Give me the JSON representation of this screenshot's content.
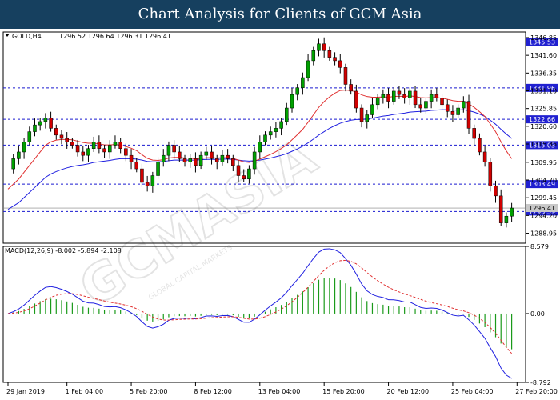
{
  "header": {
    "title": "Chart Analysis for Clients of GCM Asia"
  },
  "chart_data": {
    "type": "candlestick",
    "symbol_info": "GOLD,H4",
    "ohlc_text": "1296.52 1296.64 1296.31 1296.41",
    "price_range": [
      1286.0,
      1348.5
    ],
    "price_ticks": [
      "1346.85",
      "1341.60",
      "1336.35",
      "1331.10",
      "1325.85",
      "1320.60",
      "1315.35",
      "1309.95",
      "1304.70",
      "1299.45",
      "1294.20",
      "1288.95"
    ],
    "levels": [
      {
        "value": 1345.53,
        "label": "1345.53"
      },
      {
        "value": 1331.96,
        "label": "1331.96"
      },
      {
        "value": 1322.66,
        "label": "1322.66"
      },
      {
        "value": 1315.03,
        "label": "1315.03"
      },
      {
        "value": 1303.49,
        "label": "1303.49"
      },
      {
        "value": 1295.39,
        "label": "1295.39"
      }
    ],
    "current_price": {
      "value": 1296.41,
      "label": "1296.41"
    },
    "closes": [
      1308,
      1311,
      1313,
      1316,
      1319,
      1321,
      1322,
      1323,
      1320,
      1318,
      1317,
      1316,
      1315,
      1313,
      1312,
      1314,
      1316,
      1314,
      1313,
      1315,
      1316,
      1314,
      1312,
      1310,
      1308,
      1304,
      1303,
      1306,
      1310,
      1312,
      1315,
      1313,
      1311,
      1310,
      1311,
      1309,
      1312,
      1313,
      1311,
      1310,
      1312,
      1311,
      1309,
      1306,
      1305,
      1308,
      1313,
      1316,
      1318,
      1319,
      1320,
      1322,
      1326,
      1330,
      1332,
      1335,
      1340,
      1343,
      1345,
      1343,
      1341,
      1340,
      1338,
      1333,
      1331,
      1326,
      1322,
      1324,
      1327,
      1329,
      1330,
      1328,
      1331,
      1330,
      1329,
      1331,
      1327,
      1326,
      1328,
      1330,
      1329,
      1327,
      1325,
      1324,
      1326,
      1328,
      1320,
      1317,
      1313,
      1310,
      1303,
      1300,
      1292,
      1294,
      1296.41
    ],
    "candle_start_index": 1,
    "ema_fast": [
      1302,
      1303.5,
      1305,
      1307,
      1309,
      1311,
      1313,
      1315,
      1316,
      1316.5,
      1316.7,
      1316.7,
      1316.6,
      1316.2,
      1315.8,
      1315.6,
      1315.6,
      1315.4,
      1315.1,
      1315.1,
      1315.2,
      1315,
      1314.6,
      1314.1,
      1313.4,
      1312.2,
      1311.1,
      1310.6,
      1310.5,
      1310.7,
      1311.2,
      1311.4,
      1311.4,
      1311.2,
      1311.2,
      1310.9,
      1311,
      1311.3,
      1311.3,
      1311.2,
      1311.3,
      1311.3,
      1311.1,
      1310.6,
      1310.1,
      1309.9,
      1310.3,
      1310.9,
      1311.6,
      1312.3,
      1313.1,
      1314,
      1315.1,
      1316.6,
      1318.1,
      1319.7,
      1321.8,
      1324,
      1326.2,
      1327.9,
      1329.3,
      1330.4,
      1331.2,
      1331.3,
      1331.2,
      1330.7,
      1329.9,
      1329.4,
      1329.2,
      1329.2,
      1329.3,
      1329.2,
      1329.4,
      1329.5,
      1329.4,
      1329.6,
      1329.4,
      1329.1,
      1329,
      1329.1,
      1329.1,
      1328.9,
      1328.6,
      1328.2,
      1328,
      1328,
      1327.2,
      1326.2,
      1324.9,
      1323.5,
      1321.3,
      1319,
      1316,
      1313.3,
      1311
    ],
    "ema_slow": [
      1296,
      1297,
      1298,
      1299.5,
      1301,
      1302.5,
      1304,
      1305.5,
      1306.5,
      1307.2,
      1307.8,
      1308.3,
      1308.7,
      1309,
      1309.2,
      1309.5,
      1309.9,
      1310.1,
      1310.3,
      1310.5,
      1310.8,
      1311,
      1311,
      1311,
      1310.9,
      1310.6,
      1310.2,
      1310.1,
      1310.1,
      1310.2,
      1310.4,
      1310.6,
      1310.6,
      1310.6,
      1310.6,
      1310.6,
      1310.7,
      1310.8,
      1310.8,
      1310.8,
      1310.9,
      1310.9,
      1310.8,
      1310.6,
      1310.4,
      1310.3,
      1310.4,
      1310.6,
      1310.9,
      1311.2,
      1311.6,
      1312,
      1312.5,
      1313.2,
      1313.9,
      1314.7,
      1315.7,
      1316.8,
      1318,
      1319,
      1320,
      1320.8,
      1321.5,
      1322,
      1322.4,
      1322.6,
      1322.6,
      1322.8,
      1323,
      1323.3,
      1323.6,
      1323.8,
      1324.1,
      1324.3,
      1324.5,
      1324.8,
      1324.9,
      1325,
      1325.1,
      1325.3,
      1325.4,
      1325.5,
      1325.5,
      1325.4,
      1325.4,
      1325.5,
      1325.2,
      1324.8,
      1324.2,
      1323.5,
      1322.4,
      1321.2,
      1319.7,
      1318.3,
      1317
    ],
    "x_ticks": [
      {
        "label": "29 Jan 2019",
        "index": 0
      },
      {
        "label": "1 Feb 04:00",
        "index": 11
      },
      {
        "label": "5 Feb 20:00",
        "index": 23
      },
      {
        "label": "8 Feb 12:00",
        "index": 35
      },
      {
        "label": "13 Feb 04:00",
        "index": 47
      },
      {
        "label": "15 Feb 20:00",
        "index": 59
      },
      {
        "label": "20 Feb 12:00",
        "index": 71
      },
      {
        "label": "25 Feb 04:00",
        "index": 83
      },
      {
        "label": "27 Feb 20:00",
        "index": 95
      }
    ],
    "macd": {
      "label": "MACD(12,26,9) -8.002 -5.894 -2.108",
      "range": [
        -8.792,
        8.579
      ],
      "ticks": [
        "8.579",
        "0.00",
        "-8.792"
      ]
    },
    "colors": {
      "bull": "#00a000",
      "bear": "#d00000",
      "wick": "#000000",
      "ema_fast": "#e03030",
      "ema_slow": "#2020e0",
      "level_line": "#1a1ad0",
      "level_label_bg": "#2020d0",
      "price_label_bg": "#c8c8c8",
      "macd_hist": "#1a9a1a",
      "macd_main": "#2020e0",
      "macd_signal": "#e03030"
    }
  },
  "watermark": {
    "text": "GCMASIA",
    "subtext": "GLOBAL CAPITAL MARKETS"
  }
}
